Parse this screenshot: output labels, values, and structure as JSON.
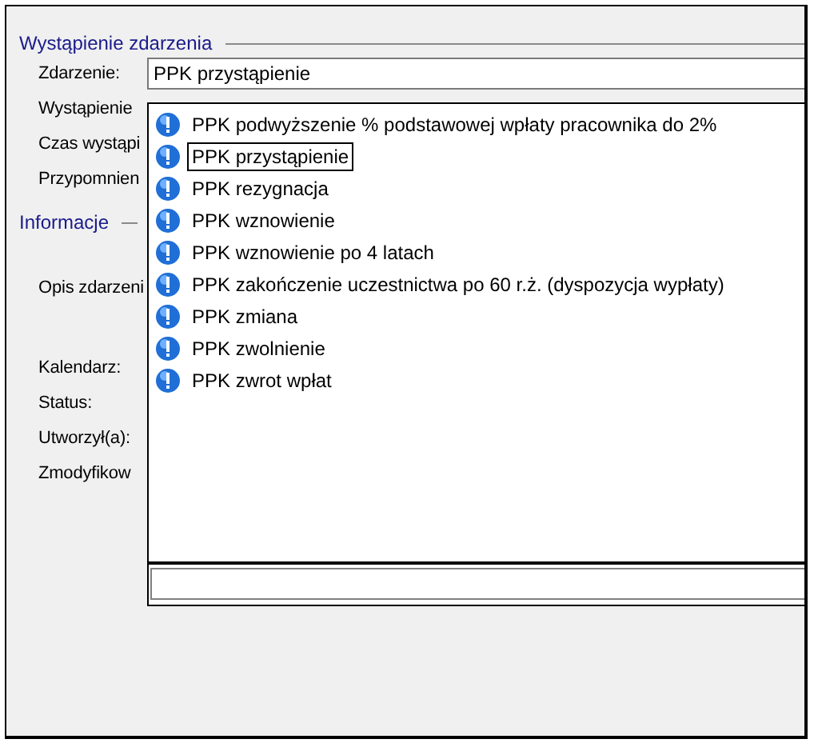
{
  "sections": [
    {
      "title": "Wystąpienie zdarzenia",
      "labels": [
        "Zdarzenie:",
        "Wystąpienie",
        "Czas wystąpi",
        "Przypomnien"
      ]
    },
    {
      "title": "Informacje",
      "labels": [
        "Opis zdarzeni",
        "Kalendarz:",
        "Status:",
        "Utworzył(a):",
        "Zmodyfikow"
      ]
    }
  ],
  "event_field": {
    "value": "PPK przystąpienie"
  },
  "dropdown": {
    "items": [
      {
        "label": "PPK podwyższenie % podstawowej wpłaty pracownika do 2%",
        "selected": false
      },
      {
        "label": "PPK przystąpienie",
        "selected": true
      },
      {
        "label": "PPK rezygnacja",
        "selected": false
      },
      {
        "label": "PPK wznowienie",
        "selected": false
      },
      {
        "label": "PPK wznowienie po 4 latach",
        "selected": false
      },
      {
        "label": "PPK zakończenie uczestnictwa po 60 r.ż. (dyspozycja wypłaty)",
        "selected": false
      },
      {
        "label": "PPK zmiana",
        "selected": false
      },
      {
        "label": "PPK zwolnienie",
        "selected": false
      },
      {
        "label": "PPK zwrot wpłat",
        "selected": false
      }
    ]
  }
}
